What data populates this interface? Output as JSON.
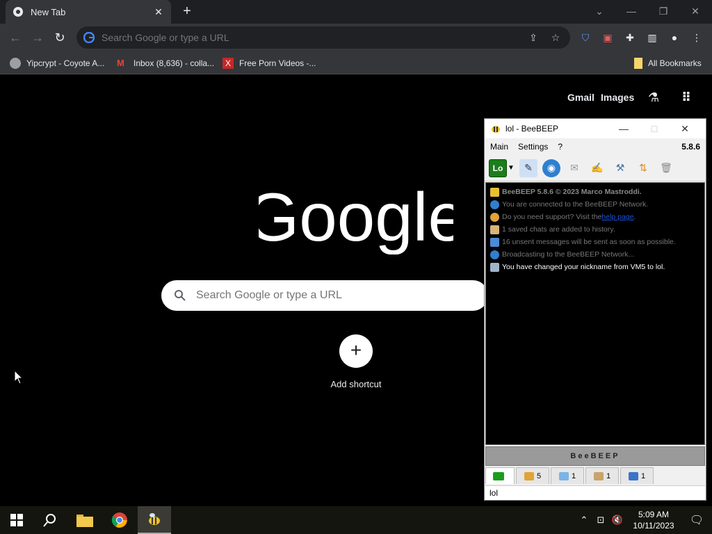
{
  "chrome": {
    "tab_title": "New Tab",
    "omnibox_placeholder": "Search Google or type a URL",
    "bookmarks": [
      {
        "label": "Yipcrypt - Coyote A..."
      },
      {
        "label": "Inbox (8,636) - colla..."
      },
      {
        "label": "Free Porn Videos -..."
      }
    ],
    "all_bookmarks": "All Bookmarks",
    "colors": {
      "tabstrip": "#1e1f22",
      "toolbar": "#35363a",
      "ntp_bg": "#000000"
    }
  },
  "ntp": {
    "gmail": "Gmail",
    "images": "Images",
    "logo_text": "Google",
    "search_placeholder": "Search Google or type a URL",
    "add_shortcut": "Add shortcut"
  },
  "beebeep": {
    "title": "lol - BeeBEEP",
    "menu": {
      "main": "Main",
      "settings": "Settings",
      "help": "?",
      "version": "5.8.6"
    },
    "status_button_label": "Lo",
    "messages": [
      {
        "text": "BeeBEEP 5.8.6 © 2023 Marco Mastroddi.",
        "icon": "bee-icon",
        "style": "head"
      },
      {
        "text": "You are connected to the BeeBEEP Network.",
        "icon": "network-icon",
        "style": "info"
      },
      {
        "text_before": "Do you need support? Visit the ",
        "link": "help page",
        "text_after": ".",
        "icon": "help-icon",
        "style": "info"
      },
      {
        "text": "1 saved chats are added to history.",
        "icon": "history-icon",
        "style": "info"
      },
      {
        "text": "16 unsent messages will be sent as soon as possible.",
        "icon": "mail-icon",
        "style": "info"
      },
      {
        "text": "Broadcasting to the BeeBEEP Network...",
        "icon": "broadcast-icon",
        "style": "info"
      },
      {
        "text": "You have changed your nickname from VM5 to lol.",
        "icon": "profile-icon",
        "style": "last"
      }
    ],
    "banner": "BeeBEEP",
    "tabs": [
      {
        "count": "5",
        "icon": "users-icon"
      },
      {
        "count": "1",
        "icon": "chats-icon"
      },
      {
        "count": "1",
        "icon": "groups-icon"
      },
      {
        "count": "1",
        "icon": "shares-icon"
      }
    ],
    "status_text": "lol"
  },
  "taskbar": {
    "time": "5:09 AM",
    "date": "10/11/2023"
  }
}
